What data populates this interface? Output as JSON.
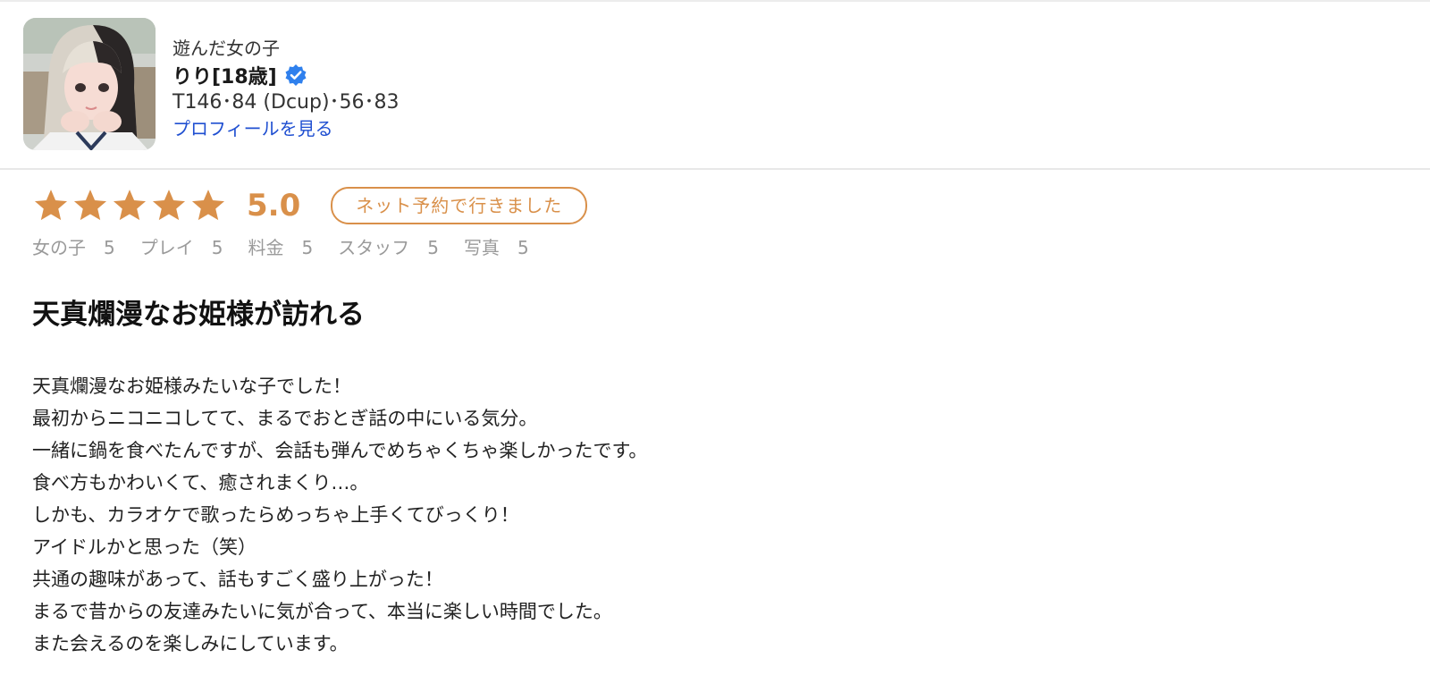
{
  "girl": {
    "played_label": "遊んだ女の子",
    "name": "りり[18歳]",
    "measurements": "T146･84 (Dcup)･56･83",
    "profile_link": "プロフィールを見る"
  },
  "rating": {
    "stars": 5,
    "score": "5.0",
    "visit_badge": "ネット予約で行きました"
  },
  "sub_ratings": [
    {
      "label": "女の子",
      "value": "5"
    },
    {
      "label": "プレイ",
      "value": "5"
    },
    {
      "label": "料金",
      "value": "5"
    },
    {
      "label": "スタッフ",
      "value": "5"
    },
    {
      "label": "写真",
      "value": "5"
    }
  ],
  "review": {
    "title": "天真爛漫なお姫様が訪れる",
    "lines": [
      "天真爛漫なお姫様みたいな子でした！",
      "最初からニコニコしてて、まるでおとぎ話の中にいる気分。",
      "一緒に鍋を食べたんですが、会話も弾んでめちゃくちゃ楽しかったです。",
      "食べ方もかわいくて、癒されまくり…。",
      "しかも、カラオケで歌ったらめっちゃ上手くてびっくり！",
      "アイドルかと思った（笑）",
      "共通の趣味があって、話もすごく盛り上がった！",
      "まるで昔からの友達みたいに気が合って、本当に楽しい時間でした。",
      "また会えるのを楽しみにしています。"
    ]
  },
  "colors": {
    "accent": "#d9904a",
    "link": "#1f4fd1",
    "verified": "#2f80ed",
    "muted": "#9a9a9a"
  },
  "icons": {
    "verified": "verified-badge-icon",
    "star": "star-icon"
  }
}
